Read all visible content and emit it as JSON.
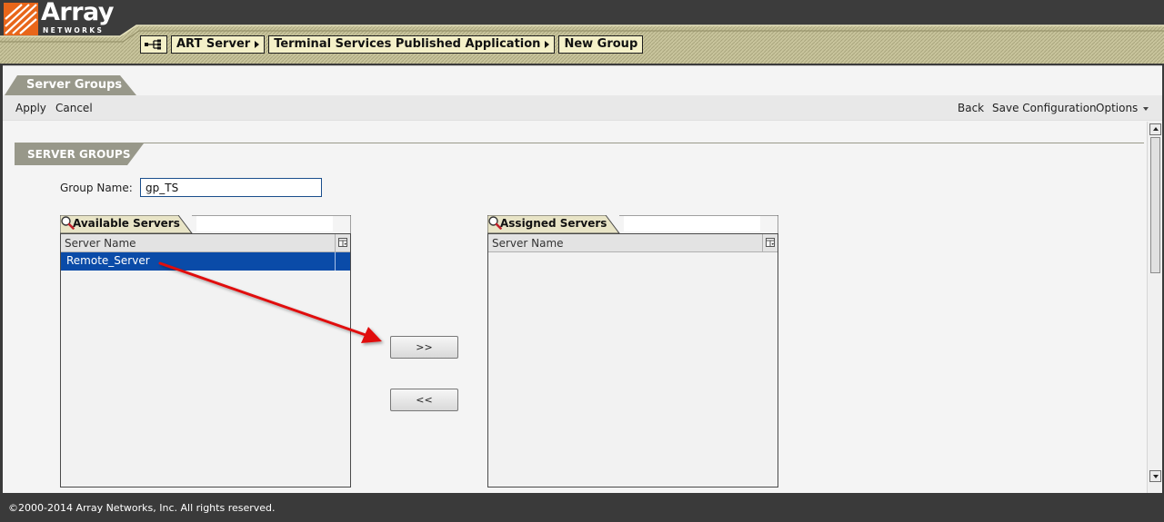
{
  "logo": {
    "word": "Array",
    "sub": "NETWORKS",
    "colors": {
      "mark": "#e8661a"
    }
  },
  "breadcrumbs": [
    {
      "label": "ART Server",
      "arrow": true
    },
    {
      "label": "Terminal Services Published Application",
      "arrow": true
    },
    {
      "label": "New Group",
      "arrow": false
    }
  ],
  "page": {
    "title": "Server Groups"
  },
  "toolbar": {
    "apply": "Apply",
    "cancel": "Cancel",
    "back": "Back",
    "save_configuration": "Save Configuration",
    "options": "Options"
  },
  "section": {
    "title": "SERVER GROUPS"
  },
  "form": {
    "group_name_label": "Group Name:",
    "group_name_value": "gp_TS"
  },
  "available": {
    "title": "Available Servers",
    "search_value": "",
    "column": "Server Name",
    "rows": [
      {
        "name": "Remote_Server",
        "selected": true
      }
    ]
  },
  "assigned": {
    "title": "Assigned Servers",
    "search_value": "",
    "column": "Server Name",
    "rows": []
  },
  "buttons": {
    "add": ">>",
    "remove": "<<"
  },
  "footer": {
    "copyright": "©2000-2014 Array Networks, Inc. All rights reserved."
  },
  "colors": {
    "selection": "#0a4ba8",
    "crumb_bg": "#f4f0c8",
    "tab_gray": "#98988a",
    "annotation_arrow": "#e01010"
  }
}
